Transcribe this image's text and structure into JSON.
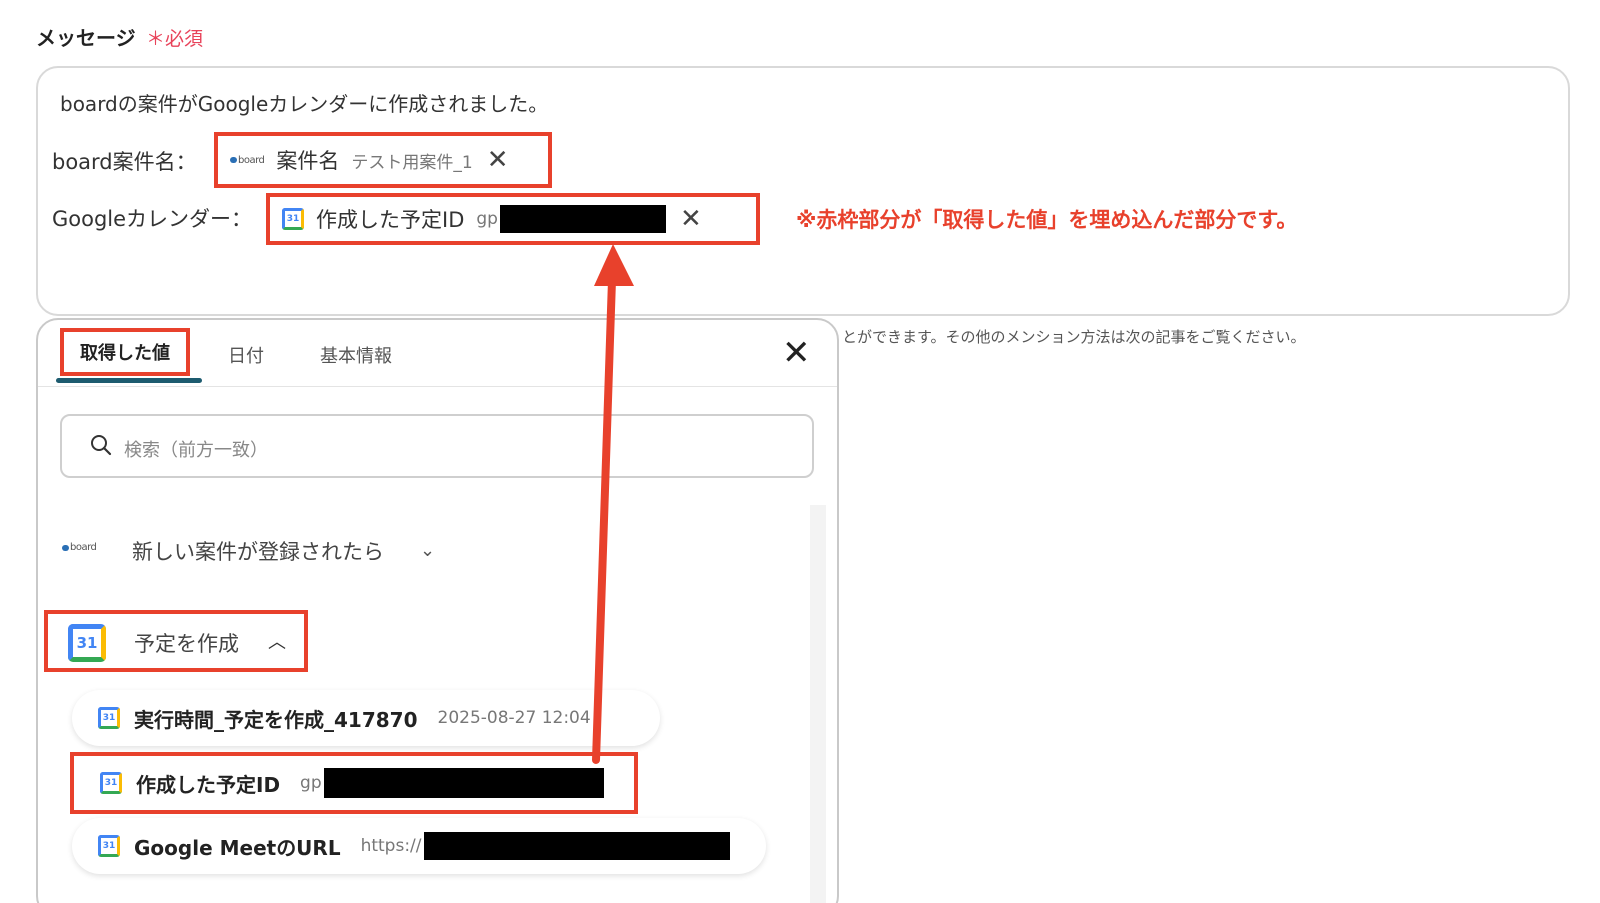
{
  "field": {
    "label": "メッセージ",
    "required": "＊必須"
  },
  "message": {
    "line1": "boardの案件がGoogleカレンダーに作成されました。",
    "row1_label": "board案件名：",
    "row2_label": "Googleカレンダー："
  },
  "tokens": {
    "t1": {
      "icon": "board-logo-icon",
      "logo_text": "board",
      "name": "案件名",
      "value": "テスト用案件_1"
    },
    "t2": {
      "icon": "google-calendar-icon",
      "icon_text": "31",
      "name": "作成した予定ID",
      "value": "gp"
    }
  },
  "annotation": "※赤枠部分が「取得した値」を埋め込んだ部分です。",
  "hint": "とができます。その他のメンション方法は次の記事をご覧ください。",
  "panel": {
    "tabs": [
      "取得した値",
      "日付",
      "基本情報"
    ],
    "search_placeholder": "検索（前方一致）",
    "group1": {
      "logo_text": "board",
      "label": "新しい案件が登録されたら",
      "state": "collapsed"
    },
    "group2": {
      "icon_text": "31",
      "label": "予定を作成",
      "state": "expanded"
    },
    "items": [
      {
        "name": "実行時間_予定を作成_417870",
        "value": "2025-08-27 12:04"
      },
      {
        "name": "作成した予定ID",
        "value": "gp"
      },
      {
        "name": "Google MeetのURL",
        "value": "https://"
      }
    ]
  },
  "colors": {
    "highlight": "#e8412c",
    "required": "#e8435a",
    "tab_underline": "#1d5b6f"
  }
}
